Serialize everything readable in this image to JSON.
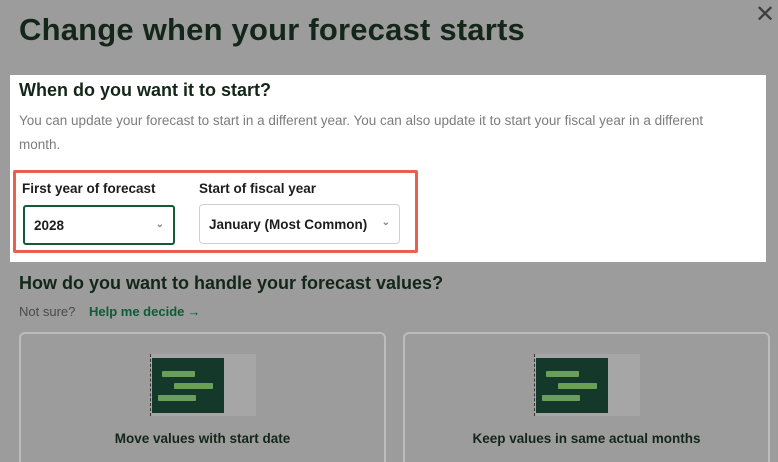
{
  "modal": {
    "title": "Change when your forecast starts",
    "close_icon": "close-icon"
  },
  "start_section": {
    "heading": "When do you want it to start?",
    "description": "You can update your forecast to start in a different year. You can also update it to start your fiscal year in a different month.",
    "first_year": {
      "label": "First year of forecast",
      "value": "2028"
    },
    "fiscal_start": {
      "label": "Start of fiscal year",
      "value": "January (Most Common)"
    }
  },
  "values_section": {
    "heading": "How do you want to handle your forecast values?",
    "not_sure": "Not sure?",
    "help_link": "Help me decide",
    "help_arrow": "→",
    "options": [
      {
        "label": "Move values with start date"
      },
      {
        "label": "Keep values in same actual months"
      }
    ]
  },
  "colors": {
    "brand_dark_green": "#142619",
    "link_green": "#0f5a37",
    "highlight_border": "#e8614e",
    "overlay_gray": "#9c9c9c"
  }
}
